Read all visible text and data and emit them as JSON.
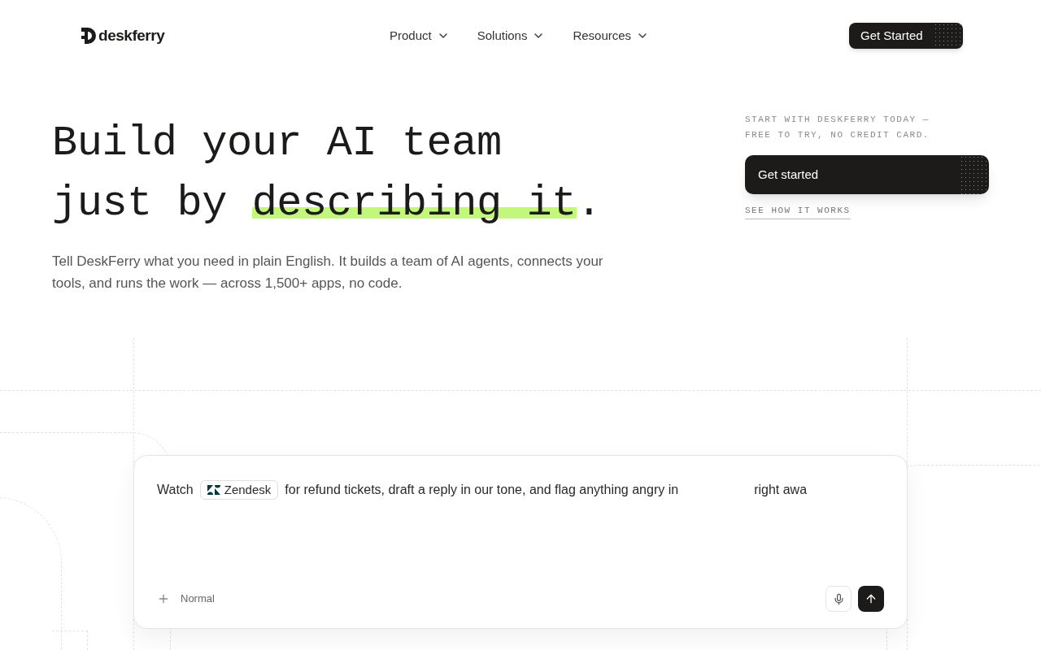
{
  "brand": {
    "name": "deskferry"
  },
  "nav": [
    {
      "label": "Product",
      "has_menu": true
    },
    {
      "label": "Solutions",
      "has_menu": true
    },
    {
      "label": "Resources",
      "has_menu": true
    }
  ],
  "header_cta": {
    "label": "Get Started"
  },
  "headline": [
    [
      {
        "text": "Build your AI team",
        "highlighted": false
      }
    ],
    [
      {
        "text": "just by ",
        "highlighted": false
      },
      {
        "text": "describing it",
        "highlighted": true
      },
      {
        "text": ".",
        "highlighted": false
      }
    ]
  ],
  "subtitle": "Tell DeskFerry what you need in plain English. It builds a team of AI agents, connects your tools, and runs the work — across 1,500+ apps, no code.",
  "side": {
    "note_lines": [
      "START WITH DESKFERRY TODAY —",
      "FREE TO TRY, NO CREDIT CARD."
    ],
    "cta": "Get started",
    "link": "SEE HOW IT WORKS"
  },
  "prompt": {
    "before": "Watch",
    "app_chip": "Zendesk",
    "after": "for refund tickets, draft a reply in our tone, and flag anything angry in",
    "tail": "right awa",
    "mode": "Normal"
  }
}
